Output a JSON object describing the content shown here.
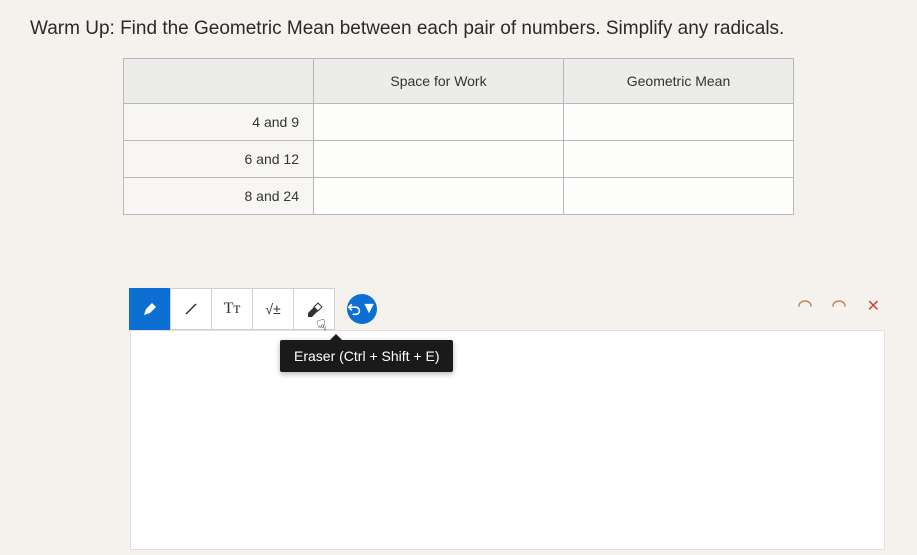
{
  "prompt": "Warm Up: Find the Geometric Mean between each pair of numbers. Simplify any radicals.",
  "table": {
    "headers": {
      "pair": "",
      "work": "Space for Work",
      "mean": "Geometric Mean"
    },
    "rows": [
      {
        "pair": "4 and 9",
        "work": "",
        "mean": ""
      },
      {
        "pair": "6 and 12",
        "work": "",
        "mean": ""
      },
      {
        "pair": "8 and 24",
        "work": "",
        "mean": ""
      }
    ]
  },
  "toolbar": {
    "pen_label": "Pen",
    "line_label": "Line",
    "text_label": "Tᴛ",
    "math_label": "√±",
    "eraser_label": "Eraser",
    "undo_label": "Undo"
  },
  "tooltip": "Eraser (Ctrl + Shift + E)"
}
